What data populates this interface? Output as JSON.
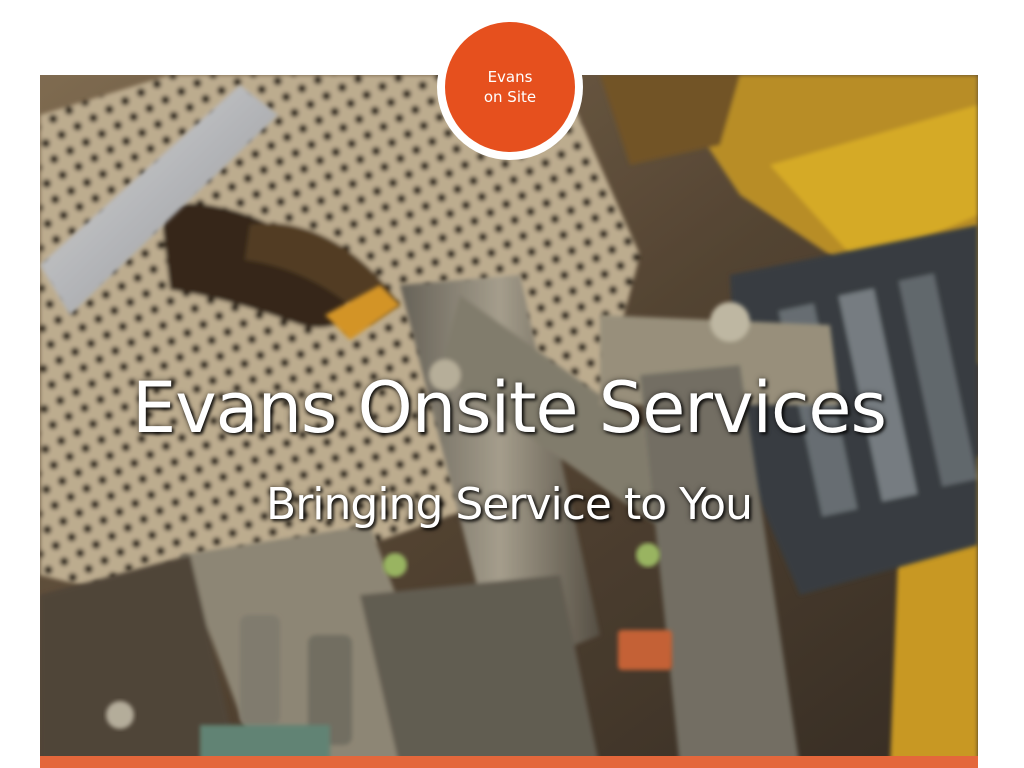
{
  "logo": {
    "line1": "Evans",
    "line2": "on Site"
  },
  "hero": {
    "title": "Evans Onsite Services",
    "subtitle": "Bringing Service to You",
    "image": "machinery-gloves-photo"
  },
  "colors": {
    "logo_orange": "#e6501e",
    "accent_bar": "#e4673b",
    "text": "#ffffff",
    "background": "#ffffff"
  }
}
